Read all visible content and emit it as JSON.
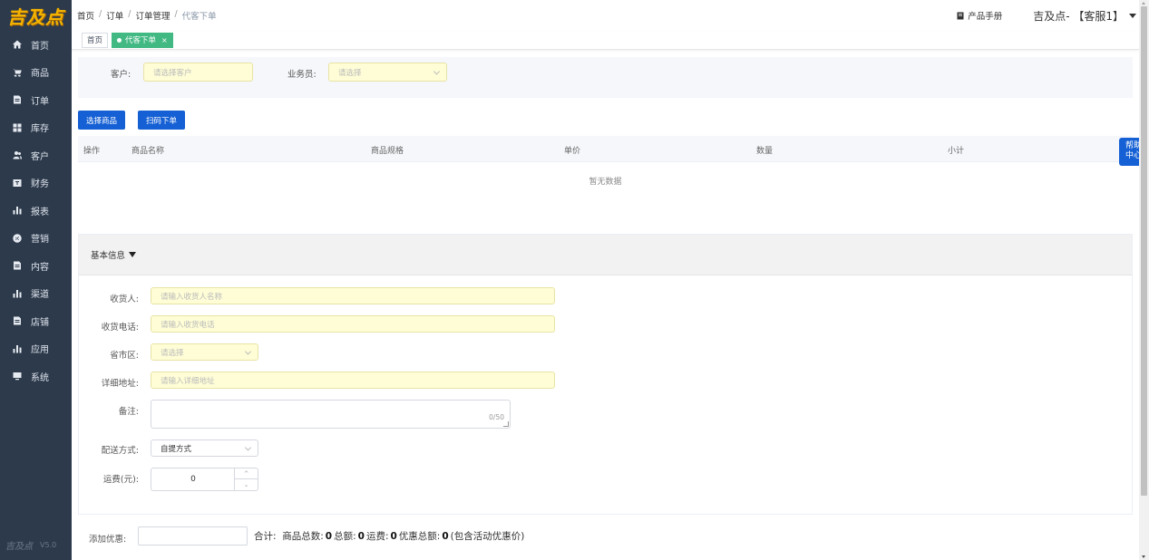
{
  "logo": "吉及点",
  "sidebar": {
    "items": [
      {
        "label": "首页",
        "icon": "home-icon"
      },
      {
        "label": "商品",
        "icon": "cart-icon"
      },
      {
        "label": "订单",
        "icon": "order-icon"
      },
      {
        "label": "库存",
        "icon": "grid-icon"
      },
      {
        "label": "客户",
        "icon": "users-icon"
      },
      {
        "label": "财务",
        "icon": "wallet-icon"
      },
      {
        "label": "报表",
        "icon": "bar-chart-icon"
      },
      {
        "label": "营销",
        "icon": "target-icon"
      },
      {
        "label": "内容",
        "icon": "document-icon"
      },
      {
        "label": "渠道",
        "icon": "bar-chart-icon"
      },
      {
        "label": "店铺",
        "icon": "document-icon"
      },
      {
        "label": "应用",
        "icon": "bar-chart-icon"
      },
      {
        "label": "系统",
        "icon": "monitor-icon"
      }
    ],
    "footer_logo": "吉及点",
    "version": "V5.0"
  },
  "breadcrumb": [
    "首页",
    "订单",
    "订单管理",
    "代客下单"
  ],
  "header": {
    "manual": "产品手册",
    "user": "吉及点- 【客服1】"
  },
  "tabs": [
    {
      "label": "首页",
      "active": false
    },
    {
      "label": "代客下单",
      "active": true,
      "close": "×"
    }
  ],
  "filters": {
    "customer_label": "客户:",
    "customer_placeholder": "请选择客户",
    "salesman_label": "业务员:",
    "salesman_placeholder": "请选择"
  },
  "buttons": {
    "select_goods": "选择商品",
    "scan_order": "扫码下单"
  },
  "table": {
    "columns": [
      "操作",
      "商品名称",
      "商品规格",
      "单价",
      "数量",
      "小计"
    ],
    "empty": "暂无数据"
  },
  "help": {
    "line1": "帮助",
    "line2": "中心"
  },
  "info": {
    "title": "基本信息",
    "receiver_label": "收货人:",
    "receiver_placeholder": "请输入收货人名称",
    "phone_label": "收货电话:",
    "phone_placeholder": "请输入收货电话",
    "region_label": "省市区:",
    "region_placeholder": "请选择",
    "address_label": "详细地址:",
    "address_placeholder": "请输入详细地址",
    "remark_label": "备注:",
    "remark_count": "0/50",
    "delivery_label": "配送方式:",
    "delivery_value": "自提方式",
    "freight_label": "运费(元):",
    "freight_value": "0",
    "stepper_up": "^",
    "stepper_down": "⌄"
  },
  "bottom": {
    "discount_label": "添加优惠:",
    "total_label": "合计:",
    "goods_count_label": "商品总数:",
    "goods_count": "0",
    "amount_label": "总额:",
    "amount": "0",
    "freight_label": "运费:",
    "freight": "0",
    "discount_total_label": "优惠总额:",
    "discount_total": "0",
    "note": "(包含活动优惠价)"
  },
  "colors": {
    "sidebar_bg": "#2d3a4b",
    "primary": "#1560d4",
    "tab_active": "#42b983",
    "input_yellow": "#fefdd6"
  }
}
